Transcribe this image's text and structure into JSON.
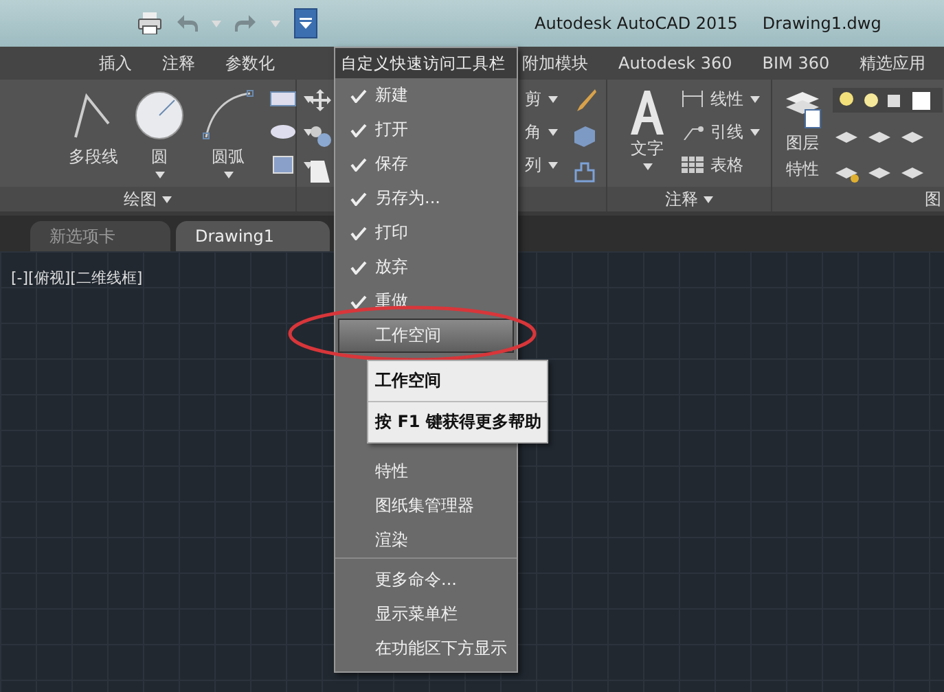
{
  "title_bar": {
    "app_title": "Autodesk AutoCAD 2015",
    "document_title": "Drawing1.dwg"
  },
  "ribbon_tabs": [
    {
      "label": "插入"
    },
    {
      "label": "注释"
    },
    {
      "label": "参数化"
    },
    {
      "label": "附加模块"
    },
    {
      "label": "Autodesk 360"
    },
    {
      "label": "BIM 360"
    },
    {
      "label": "精选应用"
    }
  ],
  "draw_panel": {
    "tools": [
      "多段线",
      "圆",
      "圆弧"
    ],
    "label": "绘图"
  },
  "modify_panel": {
    "tools": [
      "剪",
      "角",
      "列"
    ]
  },
  "annotation_panel": {
    "text_tool": "文字",
    "tools": [
      "线性",
      "引线",
      "表格"
    ],
    "label": "注释"
  },
  "layers_panel": {
    "tool": [
      "图层",
      "特性"
    ],
    "label": "图"
  },
  "file_tabs": [
    {
      "label": "新选项卡",
      "selected": false
    },
    {
      "label": "Drawing1",
      "selected": true
    }
  ],
  "viewport_label": "[-][俯视][二维线框]",
  "menu": {
    "header": "自定义快速访问工具栏",
    "groups": [
      [
        {
          "label": "新建",
          "checked": true,
          "selected": false
        },
        {
          "label": "打开",
          "checked": true,
          "selected": false
        },
        {
          "label": "保存",
          "checked": true,
          "selected": false
        },
        {
          "label": "另存为...",
          "checked": true,
          "selected": false
        },
        {
          "label": "打印",
          "checked": true,
          "selected": false
        },
        {
          "label": "放弃",
          "checked": true,
          "selected": false
        },
        {
          "label": "重做",
          "checked": true,
          "selected": false
        },
        {
          "label": "工作空间",
          "checked": false,
          "selected": true
        }
      ],
      [
        {
          "label": "特性",
          "checked": false,
          "selected": false
        },
        {
          "label": "图纸集管理器",
          "checked": false,
          "selected": false
        },
        {
          "label": "渲染",
          "checked": false,
          "selected": false
        }
      ],
      [
        {
          "label": "更多命令...",
          "checked": false,
          "selected": false
        },
        {
          "label": "显示菜单栏",
          "checked": false,
          "selected": false
        },
        {
          "label": "在功能区下方显示",
          "checked": false,
          "selected": false
        }
      ]
    ]
  },
  "tooltip": {
    "title": "工作空间",
    "help": "按 **F1** 键获得更多帮助"
  }
}
